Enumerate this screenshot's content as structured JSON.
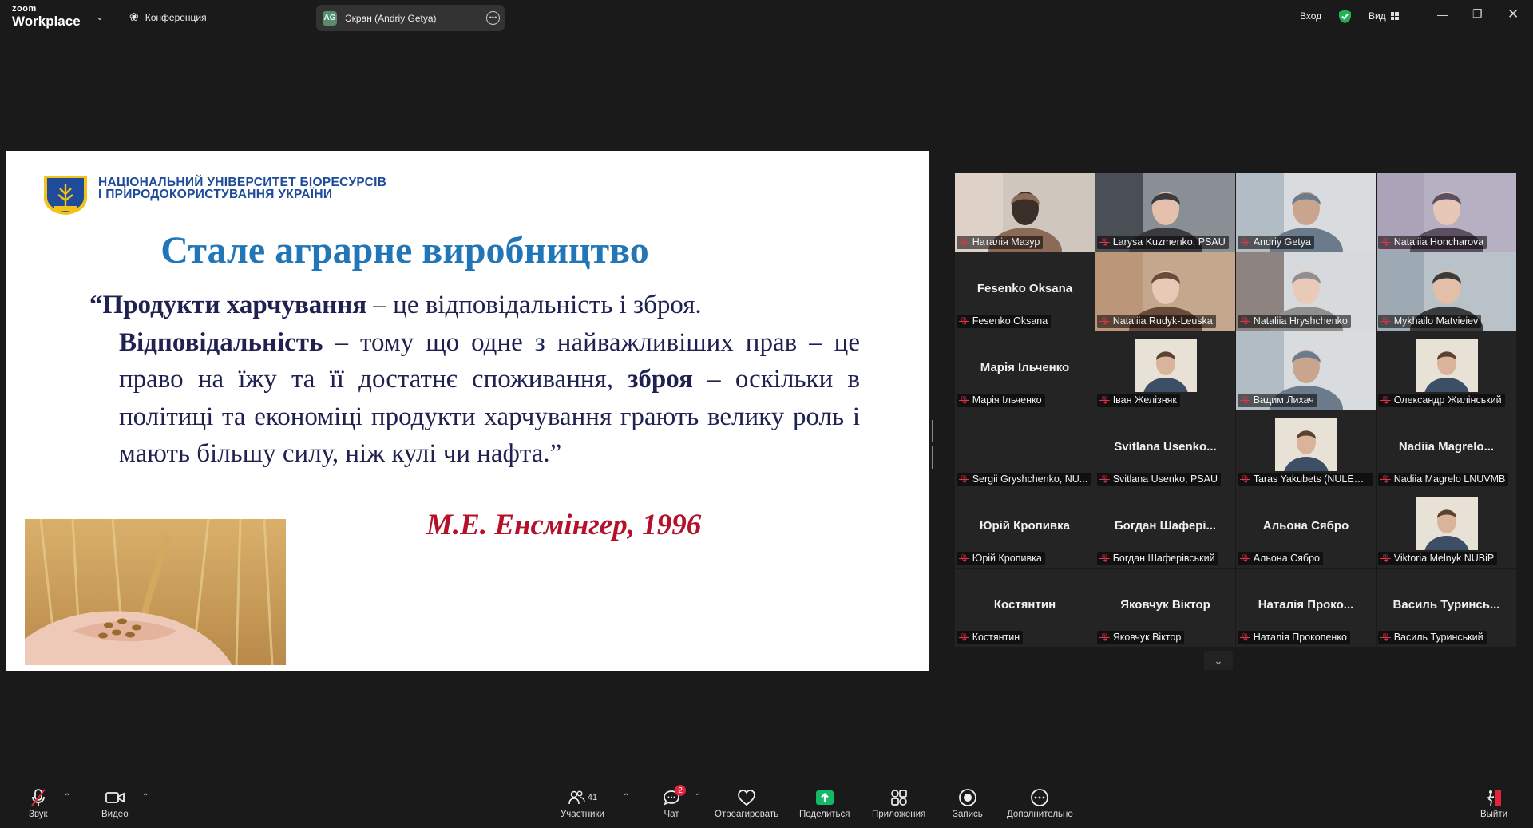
{
  "topbar": {
    "logo_small": "zoom",
    "logo_big": "Workplace",
    "conference": "Конференция",
    "share_badge": "AG",
    "share_label": "Экран (Andriy Getya)",
    "login": "Вход",
    "view": "Вид"
  },
  "slide": {
    "university_line1": "НАЦІОНАЛЬНИЙ УНІВЕРСИТЕТ БІОРЕСУРСІВ",
    "university_line2": "І ПРИРОДОКОРИСТУВАННЯ УКРАЇНИ",
    "logo_text": "НУБіП",
    "title": "Стале аграрне виробництво",
    "quote_b1": "“Продукти харчування",
    "quote_t1": " – це відповідальність і зброя.",
    "quote_b2": "Відповідальність",
    "quote_t2": " – тому що одне з найважливіших прав – це право на їжу та її достатнє споживання, ",
    "quote_b3": "зброя",
    "quote_t3": " – оскільки в політиці та економіці продукти харчування грають велику роль і мають більшу силу, ніж кулі чи нафта.”",
    "author": "М.Е. Енсмінгер, 1996"
  },
  "participants": [
    {
      "label": "Наталія Мазур",
      "type": "video"
    },
    {
      "label": "Larysa Kuzmenko, PSAU",
      "type": "video"
    },
    {
      "label": "Andriy Getya",
      "type": "video",
      "active": true
    },
    {
      "label": "Nataliia Honcharova",
      "type": "video"
    },
    {
      "label": "Fesenko Oksana",
      "display": "Fesenko Oksana",
      "type": "name"
    },
    {
      "label": "Nataliia Rudyk-Leuska",
      "type": "video"
    },
    {
      "label": "Nataliia Hryshchenko",
      "type": "video"
    },
    {
      "label": "Mykhailo Matvieiev",
      "type": "video"
    },
    {
      "label": "Марія Ільченко",
      "display": "Марія Ільченко",
      "type": "name"
    },
    {
      "label": "Іван Желізняк",
      "type": "photo"
    },
    {
      "label": "Вадим Лихач",
      "type": "video"
    },
    {
      "label": "Олександр Жилінський",
      "type": "photo"
    },
    {
      "label": "Sergii Gryshchenko, NU...",
      "type": "video"
    },
    {
      "label": "Svitlana Usenko, PSAU",
      "display": "Svitlana  Usenko...",
      "type": "name"
    },
    {
      "label": "Taras Yakubets (NULES ...",
      "type": "photo"
    },
    {
      "label": "Nadiia Magrelo LNUVMB",
      "display": "Nadiia  Magrelo...",
      "type": "name"
    },
    {
      "label": "Юрій Кропивка",
      "display": "Юрій Кропивка",
      "type": "name"
    },
    {
      "label": "Богдан Шаферівський",
      "display": "Богдан  Шафері...",
      "type": "name"
    },
    {
      "label": "Альона Сябро",
      "display": "Альона Сябро",
      "type": "name"
    },
    {
      "label": "Viktoria Melnyk NUBiP",
      "type": "photo"
    },
    {
      "label": "Костянтин",
      "display": "Костянтин",
      "type": "name"
    },
    {
      "label": "Яковчук Віктор",
      "display": "Яковчук Віктор",
      "type": "name"
    },
    {
      "label": "Наталія Прокопенко",
      "display": "Наталія  Проко...",
      "type": "name"
    },
    {
      "label": "Василь Туринський",
      "display": "Василь  Туринсь...",
      "type": "name"
    }
  ],
  "toolbar": {
    "audio": "Звук",
    "video": "Видео",
    "participants": "Участники",
    "participants_count": "41",
    "chat": "Чат",
    "chat_badge": "2",
    "react": "Отреагировать",
    "share": "Поделиться",
    "apps": "Приложения",
    "record": "Запись",
    "more": "Дополнительно",
    "leave": "Выйти"
  },
  "colors": {
    "accent_green": "#3db36a",
    "share_green": "#14b866",
    "leave_red": "#e0243d",
    "slide_title_blue": "#2176b8",
    "author_red": "#b3122a"
  },
  "icons": [
    "paw-icon",
    "shield-check-icon",
    "gallery-grid-icon",
    "minimize-icon",
    "restore-icon",
    "close-icon",
    "mic-off-icon",
    "camera-icon",
    "participants-icon",
    "chat-icon",
    "heart-icon",
    "share-up-icon",
    "apps-icon",
    "record-icon",
    "ellipsis-icon",
    "leave-icon"
  ]
}
